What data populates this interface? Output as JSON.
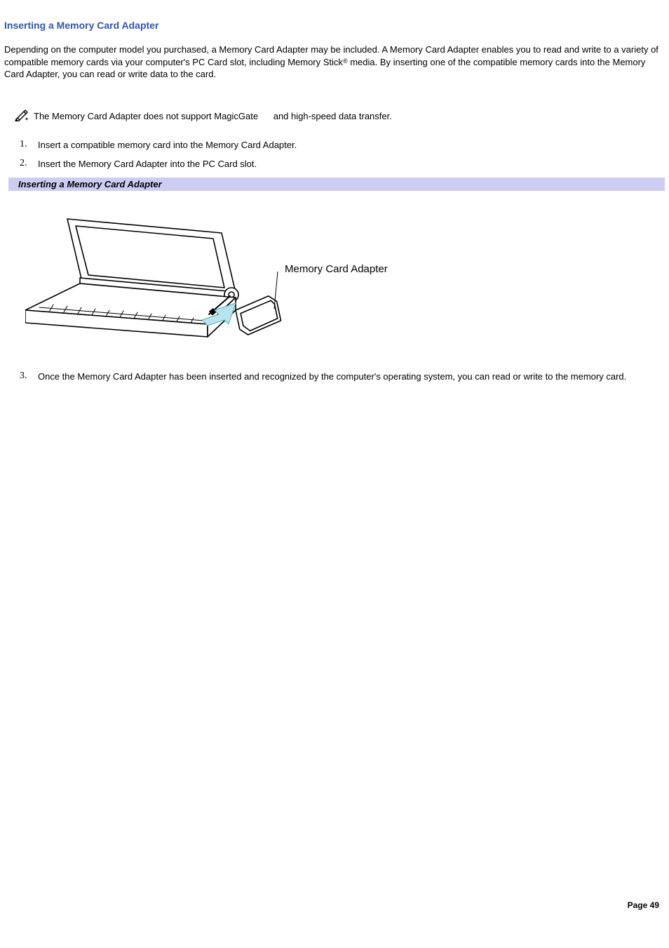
{
  "heading": "Inserting a Memory Card Adapter",
  "intro": {
    "part1": "Depending on the computer model you purchased, a Memory Card Adapter may be included. A Memory Card Adapter enables you to read and write to a variety of compatible memory cards via your computer's PC Card slot, including Memory Stick",
    "reg": "®",
    "part2": " media. By inserting one of the compatible memory cards into the Memory Card Adapter, you can read or write data to the card."
  },
  "note": {
    "part1": "The Memory Card Adapter does not support MagicGate",
    "tm": " ",
    "part2": " and high-speed data transfer."
  },
  "steps": [
    {
      "n": "1.",
      "text": "Insert a compatible memory card into the Memory Card Adapter."
    },
    {
      "n": "2.",
      "text": "Insert the Memory Card Adapter into the PC Card slot."
    }
  ],
  "figure_caption": "Inserting a Memory Card Adapter",
  "figure_label": "Memory Card Adapter",
  "step3": {
    "n": "3.",
    "text": "Once the Memory Card Adapter has been inserted and recognized by the computer's operating system, you can read or write to the memory card."
  },
  "footer": "Page 49"
}
